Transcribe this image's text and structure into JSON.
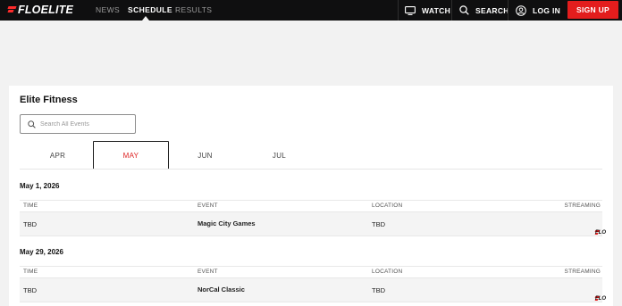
{
  "header": {
    "logo_text": "FLOELITE",
    "nav": [
      {
        "label": "NEWS"
      },
      {
        "label": "SCHEDULE",
        "active": true
      },
      {
        "label": "RESULTS"
      }
    ],
    "watch_label": "WATCH",
    "search_label": "SEARCH",
    "login_label": "LOG IN",
    "signup_label": "SIGN UP"
  },
  "page": {
    "title": "Elite Fitness",
    "search_placeholder": "Search All Events"
  },
  "months": [
    "APR",
    "MAY",
    "JUN",
    "JUL"
  ],
  "active_month": "MAY",
  "columns": {
    "time": "TIME",
    "event": "EVENT",
    "location": "LOCATION",
    "streaming": "STREAMING"
  },
  "days": [
    {
      "date": "May 1, 2026",
      "events": [
        {
          "time": "TBD",
          "event": "Magic City Games",
          "location": "TBD",
          "streaming": "FLO"
        }
      ]
    },
    {
      "date": "May 29, 2026",
      "events": [
        {
          "time": "TBD",
          "event": "NorCal Classic",
          "location": "TBD",
          "streaming": "FLO"
        }
      ]
    }
  ],
  "colors": {
    "brand_red": "#e31d1d",
    "topbar": "#0f0f10",
    "page_bg": "#f2f2f2"
  }
}
